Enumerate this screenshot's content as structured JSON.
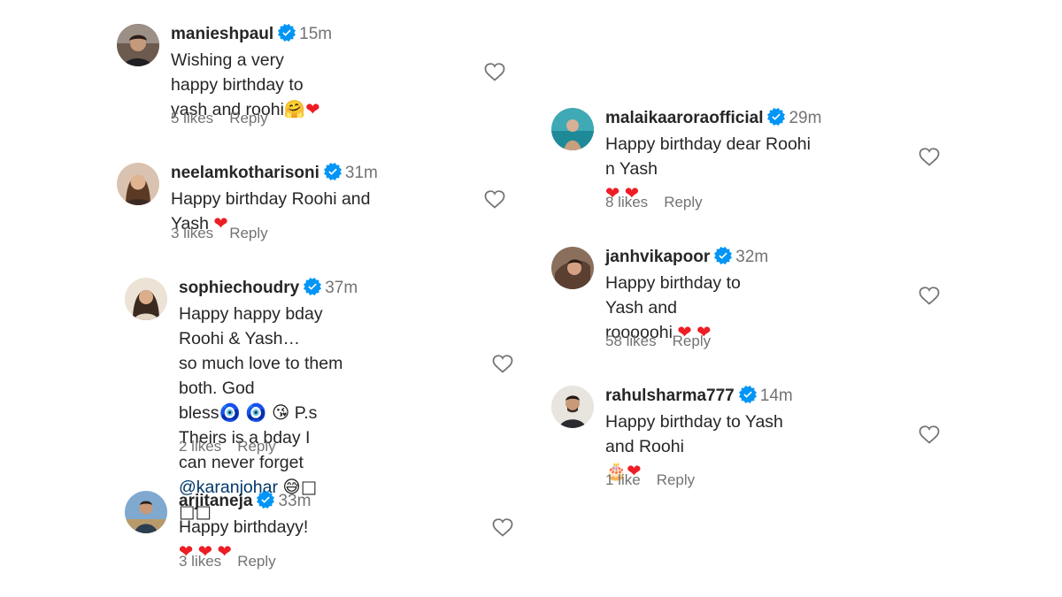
{
  "comments": [
    {
      "username": "manieshpaul",
      "time": "15m",
      "lines": [
        "Wishing a very happy birthday to",
        "yash and roohi"
      ],
      "emoji": [
        "🤗",
        "❤"
      ],
      "likes": "5 likes",
      "reply": "Reply"
    },
    {
      "username": "neelamkotharisoni",
      "time": "31m",
      "lines": [
        "Happy birthday Roohi and Yash "
      ],
      "emoji": [
        "❤"
      ],
      "likes": "3 likes",
      "reply": "Reply"
    },
    {
      "username": "sophiechoudry",
      "time": "37m",
      "lines": [
        "Happy happy bday Roohi & Yash…",
        "so much love to them both. God",
        "bless",
        " P.s Theirs is a bday I",
        "can never forget ",
        "@karanjohar",
        "□"
      ],
      "emoji": [
        "🧿",
        "🧿",
        "😘",
        "😅",
        "□"
      ],
      "likes": "2 likes",
      "reply": "Reply"
    },
    {
      "username": "arjitaneja",
      "time": "33m",
      "lines": [
        "Happy birthdayy! "
      ],
      "emoji": [
        "❤",
        "❤",
        "❤"
      ],
      "likes": "3 likes",
      "reply": "Reply"
    },
    {
      "username": "malaikaaroraofficial",
      "time": "29m",
      "lines": [
        "Happy birthday dear Roohi n Yash"
      ],
      "emoji": [
        "❤",
        "❤"
      ],
      "likes": "8 likes",
      "reply": "Reply"
    },
    {
      "username": "janhvikapoor",
      "time": "32m",
      "lines": [
        "Happy birthday to Yash and",
        "roooooh"
      ],
      "emoji": [
        "❤",
        "❤"
      ],
      "likes": "58 likes",
      "reply": "Reply"
    },
    {
      "username": "rahulsharma777",
      "time": "14m",
      "lines": [
        "Happy birthday to Yash and Roohi"
      ],
      "emoji": [
        "🎂",
        "❤"
      ],
      "likes": "1 like",
      "reply": "Reply"
    }
  ],
  "icons": {
    "verified": "verified-badge-icon",
    "like": "heart-outline-icon"
  },
  "colors": {
    "verified": "#0095f6",
    "heart": "#ed1d24",
    "muted": "#737373",
    "mention": "#00376b",
    "text": "#262626"
  }
}
